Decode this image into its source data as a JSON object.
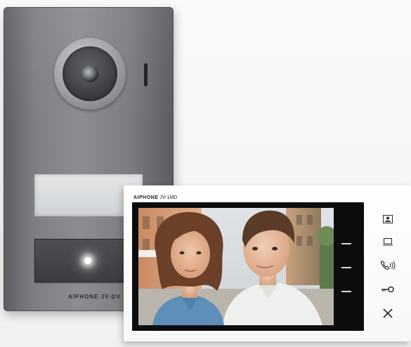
{
  "door_station": {
    "brand_label": "AIPHONE JV-DV"
  },
  "monitor": {
    "brand_name": "AIPHONE",
    "model_label": "JV-1MD",
    "buttons": [
      {
        "icon": "camera-person-icon"
      },
      {
        "icon": "monitor-icon"
      },
      {
        "icon": "talk-icon"
      },
      {
        "icon": "key-icon"
      },
      {
        "icon": "close-icon"
      }
    ]
  }
}
